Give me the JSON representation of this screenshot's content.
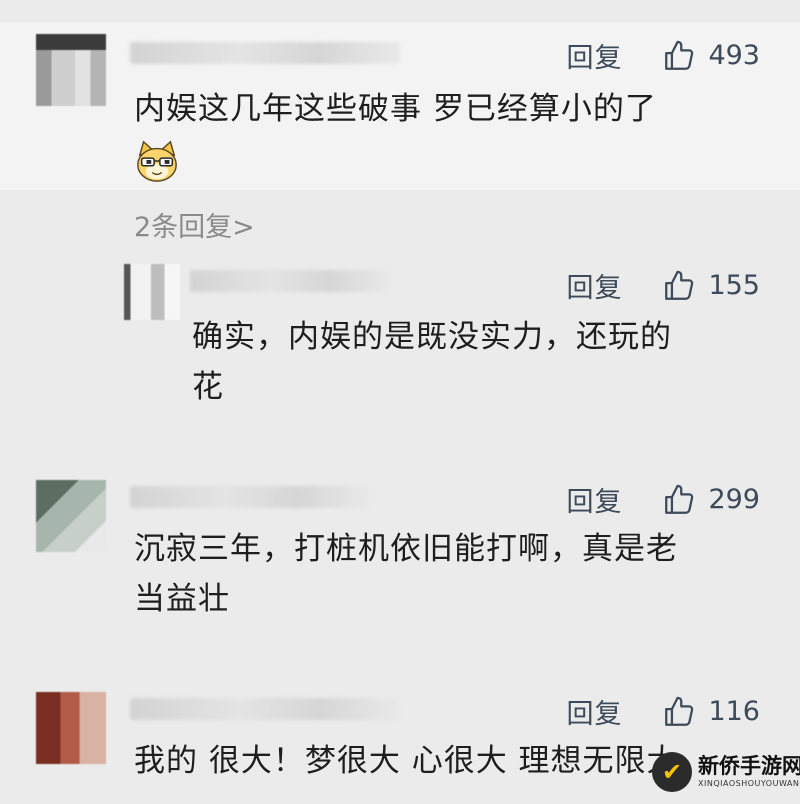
{
  "comments": [
    {
      "reply_label": "回复",
      "likes": "493",
      "text_lines": [
        "内娱这几年这些破事 罗已经算小的了"
      ],
      "emoji": "cat-glasses-emoji",
      "more_replies": "2条回复>"
    },
    {
      "reply_label": "回复",
      "likes": "155",
      "text_lines": [
        "确实，内娱的是既没实力，还玩的",
        "花"
      ]
    },
    {
      "reply_label": "回复",
      "likes": "299",
      "text_lines": [
        "沉寂三年，打桩机依旧能打啊，真是老",
        "当益壮"
      ]
    },
    {
      "reply_label": "回复",
      "likes": "116",
      "text_lines": [
        "我的 很大！梦很大 心很大 理想无限大"
      ]
    }
  ],
  "watermark": {
    "title": "新侨手游网",
    "subtitle": "XINQIAOSHOUYOUWANG",
    "logo_glyph": "✔"
  },
  "icons": {
    "like": "thumbs-up-icon"
  },
  "colors": {
    "background": "#ebebeb",
    "highlight_band": "#f3f3f3",
    "action_text": "#3e4a5a",
    "body_text": "#1e1e1e",
    "muted_text": "#8a8a8a"
  }
}
